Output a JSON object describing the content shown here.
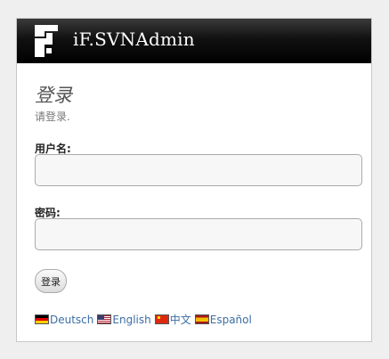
{
  "app": {
    "title": "iF.SVNAdmin",
    "logo_icon": "svnadmin-logo-icon"
  },
  "login": {
    "heading": "登录",
    "subtitle": "请登录.",
    "username_label": "用户名:",
    "username_value": "",
    "password_label": "密码:",
    "password_value": "",
    "submit_label": "登录"
  },
  "languages": [
    {
      "label": "Deutsch",
      "flag": "de-flag-icon"
    },
    {
      "label": "English",
      "flag": "us-flag-icon"
    },
    {
      "label": "中文",
      "flag": "cn-flag-icon"
    },
    {
      "label": "Español",
      "flag": "es-flag-icon"
    }
  ],
  "colors": {
    "header_bg": "#000000",
    "header_text": "#ffffff",
    "link": "#3b6ea5",
    "heading": "#555555"
  }
}
